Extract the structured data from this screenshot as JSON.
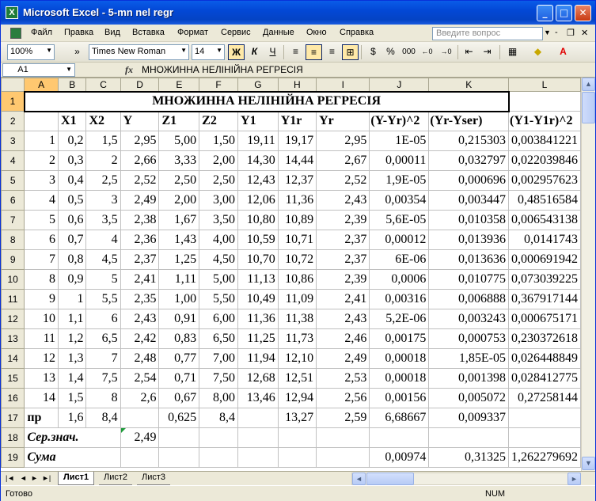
{
  "window": {
    "title": "Microsoft Excel - 5-mn nel regr",
    "app_icon": "X"
  },
  "menu": {
    "items": [
      "Файл",
      "Правка",
      "Вид",
      "Вставка",
      "Формат",
      "Сервис",
      "Данные",
      "Окно",
      "Справка"
    ],
    "ask_placeholder": "Введите вопрос"
  },
  "toolbar": {
    "zoom": "100%",
    "font_name": "Times New Roman",
    "font_size": "14",
    "bold": "Ж",
    "italic": "К",
    "underline": "Ч",
    "percent": "%",
    "thousands": "000"
  },
  "formula_bar": {
    "cell_ref": "A1",
    "fx": "fx",
    "content": "МНОЖИННА НЕЛІНІЙНА РЕГРЕСІЯ"
  },
  "columns": [
    "A",
    "B",
    "C",
    "D",
    "E",
    "F",
    "G",
    "H",
    "I",
    "J",
    "K",
    "L"
  ],
  "sheet_title": "МНОЖИННА НЕЛІНІЙНА РЕГРЕСІЯ",
  "header_row": [
    "",
    "X1",
    "X2",
    "Y",
    "Z1",
    "Z2",
    "Y1",
    "Y1r",
    "Yr",
    "(Y-Yr)^2",
    "(Yr-Yser)",
    "(Y1-Y1r)^2"
  ],
  "data_rows": [
    [
      "1",
      "0,2",
      "1,5",
      "2,95",
      "5,00",
      "1,50",
      "19,11",
      "19,17",
      "2,95",
      "1E-05",
      "0,215303",
      "0,003841221"
    ],
    [
      "2",
      "0,3",
      "2",
      "2,66",
      "3,33",
      "2,00",
      "14,30",
      "14,44",
      "2,67",
      "0,00011",
      "0,032797",
      "0,022039846"
    ],
    [
      "3",
      "0,4",
      "2,5",
      "2,52",
      "2,50",
      "2,50",
      "12,43",
      "12,37",
      "2,52",
      "1,9E-05",
      "0,000696",
      "0,002957623"
    ],
    [
      "4",
      "0,5",
      "3",
      "2,49",
      "2,00",
      "3,00",
      "12,06",
      "11,36",
      "2,43",
      "0,00354",
      "0,003447",
      "0,48516584"
    ],
    [
      "5",
      "0,6",
      "3,5",
      "2,38",
      "1,67",
      "3,50",
      "10,80",
      "10,89",
      "2,39",
      "5,6E-05",
      "0,010358",
      "0,006543138"
    ],
    [
      "6",
      "0,7",
      "4",
      "2,36",
      "1,43",
      "4,00",
      "10,59",
      "10,71",
      "2,37",
      "0,00012",
      "0,013936",
      "0,0141743"
    ],
    [
      "7",
      "0,8",
      "4,5",
      "2,37",
      "1,25",
      "4,50",
      "10,70",
      "10,72",
      "2,37",
      "6E-06",
      "0,013636",
      "0,000691942"
    ],
    [
      "8",
      "0,9",
      "5",
      "2,41",
      "1,11",
      "5,00",
      "11,13",
      "10,86",
      "2,39",
      "0,0006",
      "0,010775",
      "0,073039225"
    ],
    [
      "9",
      "1",
      "5,5",
      "2,35",
      "1,00",
      "5,50",
      "10,49",
      "11,09",
      "2,41",
      "0,00316",
      "0,006888",
      "0,367917144"
    ],
    [
      "10",
      "1,1",
      "6",
      "2,43",
      "0,91",
      "6,00",
      "11,36",
      "11,38",
      "2,43",
      "5,2E-06",
      "0,003243",
      "0,000675171"
    ],
    [
      "11",
      "1,2",
      "6,5",
      "2,42",
      "0,83",
      "6,50",
      "11,25",
      "11,73",
      "2,46",
      "0,00175",
      "0,000753",
      "0,230372618"
    ],
    [
      "12",
      "1,3",
      "7",
      "2,48",
      "0,77",
      "7,00",
      "11,94",
      "12,10",
      "2,49",
      "0,00018",
      "1,85E-05",
      "0,026448849"
    ],
    [
      "13",
      "1,4",
      "7,5",
      "2,54",
      "0,71",
      "7,50",
      "12,68",
      "12,51",
      "2,53",
      "0,00018",
      "0,001398",
      "0,028412775"
    ],
    [
      "14",
      "1,5",
      "8",
      "2,6",
      "0,67",
      "8,00",
      "13,46",
      "12,94",
      "2,56",
      "0,00156",
      "0,005072",
      "0,27258144"
    ]
  ],
  "row17": [
    "пр",
    "1,6",
    "8,4",
    "",
    "0,625",
    "8,4",
    "",
    "13,27",
    "2,59",
    "6,68667",
    "0,009337",
    ""
  ],
  "row18": {
    "label": "Сер.знач.",
    "d": "2,49"
  },
  "row19": {
    "label": "Сума",
    "j": "0,00974",
    "k": "0,31325",
    "l": "1,262279692"
  },
  "sheet_tabs": [
    "Лист1",
    "Лист2",
    "Лист3"
  ],
  "status": {
    "ready": "Готово",
    "num": "NUM"
  },
  "colors": {
    "accent_red": "#e00000",
    "title_bar": "#0a5ce8"
  }
}
